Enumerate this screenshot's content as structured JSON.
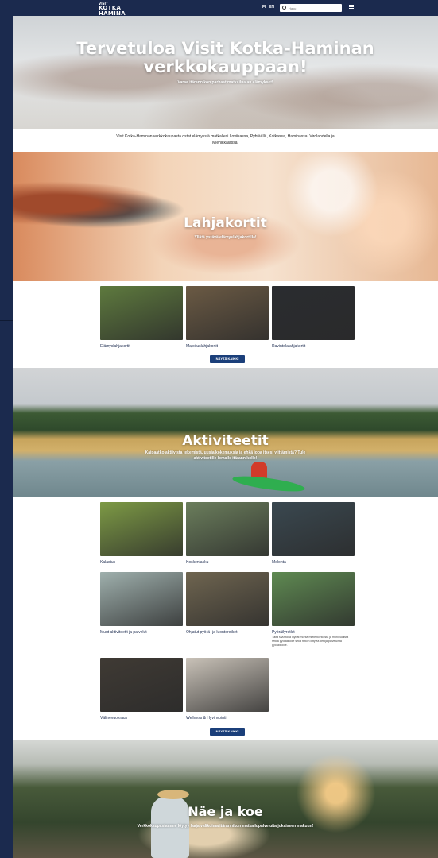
{
  "header": {
    "logo_small": "VISIT",
    "logo_line1": "KOTKA",
    "logo_line2": "HAMINA",
    "lang_fi": "FI",
    "lang_en": "EN",
    "search_placeholder": "Haku"
  },
  "hero": {
    "title": "Tervetuloa Visit Kotka-Haminan verkkokauppaan!",
    "subtitle": "Varaa itärannikon parhaat matkailualan elämykset!"
  },
  "intro": "Visit Kotka-Haminan verkkokaupasta ostat elämyksiä matkallesi Loviisassa, Pyhtäällä, Kotkassa, Haminassa, Virolahdella ja Miehikkälässä.",
  "gift_banner": {
    "title": "Lahjakortit",
    "subtitle": "Yllätä ystävä elämyslahjakortilla!"
  },
  "gift_cards": [
    {
      "label": "Elämyslahjakortit",
      "color": "#5e7a3e"
    },
    {
      "label": "Majoituslahjakortit",
      "color": "#6b5a44"
    },
    {
      "label": "Ravintolalahjakortit",
      "color": "#2a2c30"
    }
  ],
  "show_all_1": "NÄYTÄ KAIKKI",
  "activity_banner": {
    "title": "Aktiviteetit",
    "subtitle": "Kaipaatko aktiivista tekemistä, uusia kokemuksia ja ehkä jopa itsesi ylittämistä? Tule aktiviteetille lomalle itärannikolle!"
  },
  "activities": [
    {
      "label": "Kalastus",
      "desc": "",
      "color": "#7d9a45"
    },
    {
      "label": "Koskenlasku",
      "desc": "",
      "color": "#6b7e5c"
    },
    {
      "label": "Melonta",
      "desc": "",
      "color": "#3a4850"
    },
    {
      "label": "Muut aktiviteetit ja palvelut",
      "desc": "",
      "color": "#9fb0ad"
    },
    {
      "label": "Ohjatut pyörä- ja luontoretket",
      "desc": "",
      "color": "#6f6550"
    },
    {
      "label": "Pyöräilyretkit",
      "desc": "Tältä sivustolta löydät monta mielenkiintoista ja monipuolista retkiä pyöräilijöille sekä retkiin liittyviä tietoja palveluista pyöräilijöille.",
      "color": "#5f8a52"
    },
    {
      "label": "Välinevuokraus",
      "desc": "",
      "color": "#3f3a34"
    },
    {
      "label": "Wellness & Hyvinvointi",
      "desc": "",
      "color": "#c9c2b8"
    }
  ],
  "show_all_2": "NÄYTÄ KAIKKI",
  "see_banner": {
    "title": "Näe ja koe",
    "subtitle": "Verkkokaupastamme löytyy laaja valikoima itärannikon matkailupalveluita jokaiseen makuun!"
  }
}
